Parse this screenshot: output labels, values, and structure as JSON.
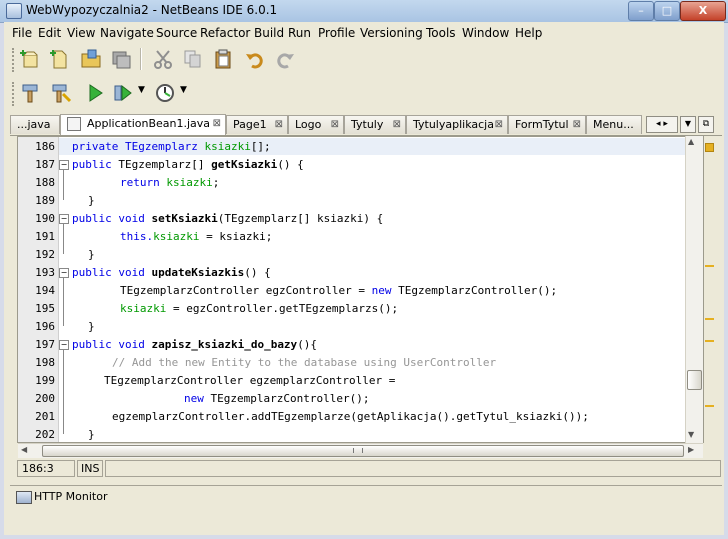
{
  "window": {
    "title": "WebWypozyczalnia2 - NetBeans IDE 6.0.1",
    "min": "–",
    "max": "□",
    "close": "X"
  },
  "menu": [
    "File",
    "Edit",
    "View",
    "Navigate",
    "Source",
    "Refactor",
    "Build",
    "Run",
    "Profile",
    "Versioning",
    "Tools",
    "Window",
    "Help"
  ],
  "tabs": [
    {
      "label": "...java"
    },
    {
      "label": "ApplicationBean1.java",
      "active": true
    },
    {
      "label": "Page1"
    },
    {
      "label": "Logo"
    },
    {
      "label": "Tytuly"
    },
    {
      "label": "Tytulyaplikacja"
    },
    {
      "label": "FormTytul"
    },
    {
      "label": "Menu..."
    }
  ],
  "tab_close": "⊠",
  "editor": {
    "line_numbers": [
      "186",
      "187",
      "188",
      "189",
      "190",
      "191",
      "192",
      "193",
      "194",
      "195",
      "196",
      "197",
      "198",
      "199",
      "200",
      "201",
      "202"
    ],
    "lines": {
      "l186a": "private TEgzemplarz ",
      "l186b": "ksiazki",
      "l186c": "[];",
      "l187a": "public ",
      "l187b": "TEgzemplarz[] ",
      "l187c": "getKsiazki",
      "l187d": "() {",
      "l188a": "return ",
      "l188b": "ksiazki",
      "l188c": ";",
      "l189": "}",
      "l190a": "public void ",
      "l190b": "setKsiazki",
      "l190c": "(TEgzemplarz[] ksiazki) {",
      "l191a": "this.",
      "l191b": "ksiazki",
      "l191c": " = ksiazki;",
      "l192": "}",
      "l193a": "public void ",
      "l193b": "updateKsiazkis",
      "l193c": "() {",
      "l194a": "TEgzemplarzController egzController = ",
      "l194b": "new ",
      "l194c": "TEgzemplarzController();",
      "l195a": "ksiazki",
      "l195b": " = egzController.getTEgzemplarzs();",
      "l196": "}",
      "l197a": "public void ",
      "l197b": "zapisz_ksiazki_do_bazy",
      "l197c": "(){",
      "l198": "// Add the new Entity to the database using UserController",
      "l199": "TEgzemplarzController egzemplarzController =",
      "l200a": "new ",
      "l200b": "TEgzemplarzController();",
      "l201": "egzemplarzController.addTEgzemplarze(getAplikacja().getTytul_ksiazki());",
      "l202": "}"
    }
  },
  "status": {
    "position": "186:3",
    "mode": "INS"
  },
  "bottom_panel": {
    "http_monitor": "HTTP Monitor"
  },
  "colors": {
    "keyword": "#0000e6",
    "field": "#009900",
    "comment": "#969696",
    "marker": "#e5b021"
  }
}
